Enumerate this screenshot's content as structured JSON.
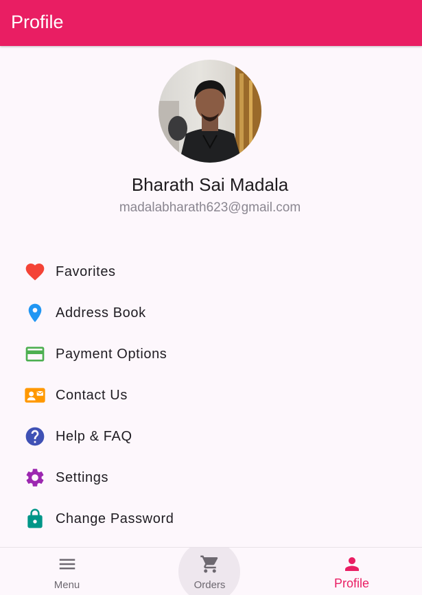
{
  "appbar": {
    "title": "Profile",
    "color": "#e91e63"
  },
  "profile": {
    "name": "Bharath Sai Madala",
    "email": "madalabharath623@gmail.com"
  },
  "menu": [
    {
      "label": "Favorites",
      "icon": "heart-icon",
      "color": "#f44336"
    },
    {
      "label": "Address Book",
      "icon": "location-pin-icon",
      "color": "#2196f3"
    },
    {
      "label": "Payment Options",
      "icon": "credit-card-icon",
      "color": "#4caf50"
    },
    {
      "label": "Contact Us",
      "icon": "contact-card-icon",
      "color": "#ff9800"
    },
    {
      "label": "Help & FAQ",
      "icon": "help-icon",
      "color": "#3f51b5"
    },
    {
      "label": "Settings",
      "icon": "gear-icon",
      "color": "#9c27b0"
    },
    {
      "label": "Change Password",
      "icon": "lock-icon",
      "color": "#009688"
    }
  ],
  "bottom_nav": {
    "items": [
      {
        "label": "Menu",
        "icon": "menu-icon"
      },
      {
        "label": "Orders",
        "icon": "cart-icon"
      },
      {
        "label": "Profile",
        "icon": "person-icon"
      }
    ],
    "active": "Profile"
  }
}
